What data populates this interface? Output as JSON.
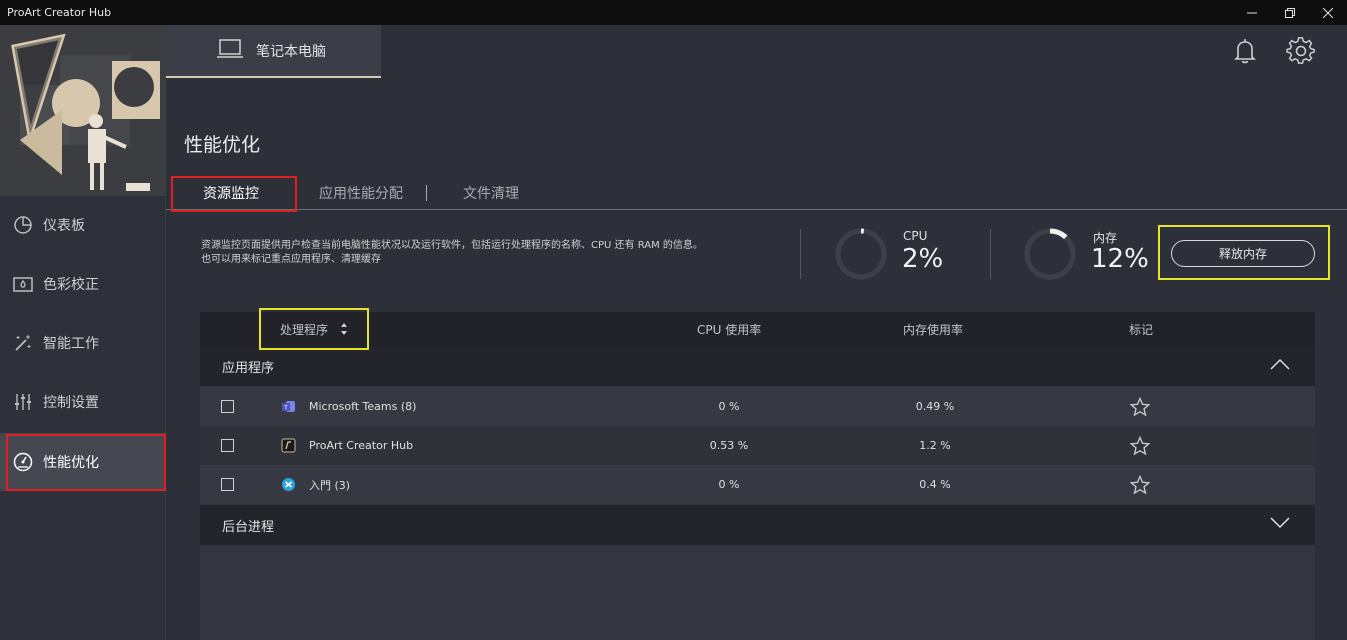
{
  "window": {
    "title": "ProArt Creator Hub"
  },
  "sidebar": {
    "items": [
      {
        "label": "仪表板",
        "icon": "dashboard-pie-icon"
      },
      {
        "label": "色彩校正",
        "icon": "color-calibration-icon"
      },
      {
        "label": "智能工作",
        "icon": "magic-wand-icon"
      },
      {
        "label": "控制设置",
        "icon": "sliders-icon"
      },
      {
        "label": "性能优化",
        "icon": "speedometer-icon",
        "active": true
      }
    ]
  },
  "header": {
    "device_label": "笔记本电脑"
  },
  "page": {
    "title": "性能优化",
    "tabs": [
      {
        "label": "资源监控",
        "active": true
      },
      {
        "label": "应用性能分配",
        "active": false
      },
      {
        "label": "文件清理",
        "active": false
      }
    ],
    "description_line1": "资源监控页面提供用户检查当前电脑性能状况以及运行软件，包括运行处理程序的名称、CPU 还有 RAM 的信息。",
    "description_line2": "也可以用来标记重点应用程序、清理缓存"
  },
  "monitor": {
    "cpu_label": "CPU",
    "cpu_value": "2%",
    "cpu_fraction": 0.02,
    "memory_label": "内存",
    "memory_value": "12%",
    "memory_fraction": 0.12,
    "release_button": "释放内存"
  },
  "table": {
    "headers": {
      "process": "处理程序",
      "cpu": "CPU 使用率",
      "memory": "内存使用率",
      "mark": "标记"
    },
    "groups": {
      "apps": "应用程序",
      "background": "后台进程"
    },
    "rows": [
      {
        "name": "Microsoft Teams (8)",
        "cpu": "0 %",
        "memory": "0.49 %",
        "icon": "teams-icon"
      },
      {
        "name": "ProArt Creator Hub",
        "cpu": "0.53 %",
        "memory": "1.2 %",
        "icon": "proart-icon"
      },
      {
        "name": "入門 (3)",
        "cpu": "0 %",
        "memory": "0.4 %",
        "icon": "tips-icon"
      }
    ]
  },
  "colors": {
    "accent_gold": "#d6c9b4",
    "highlight_red": "#e02020",
    "highlight_yellow": "#e6e32a"
  }
}
